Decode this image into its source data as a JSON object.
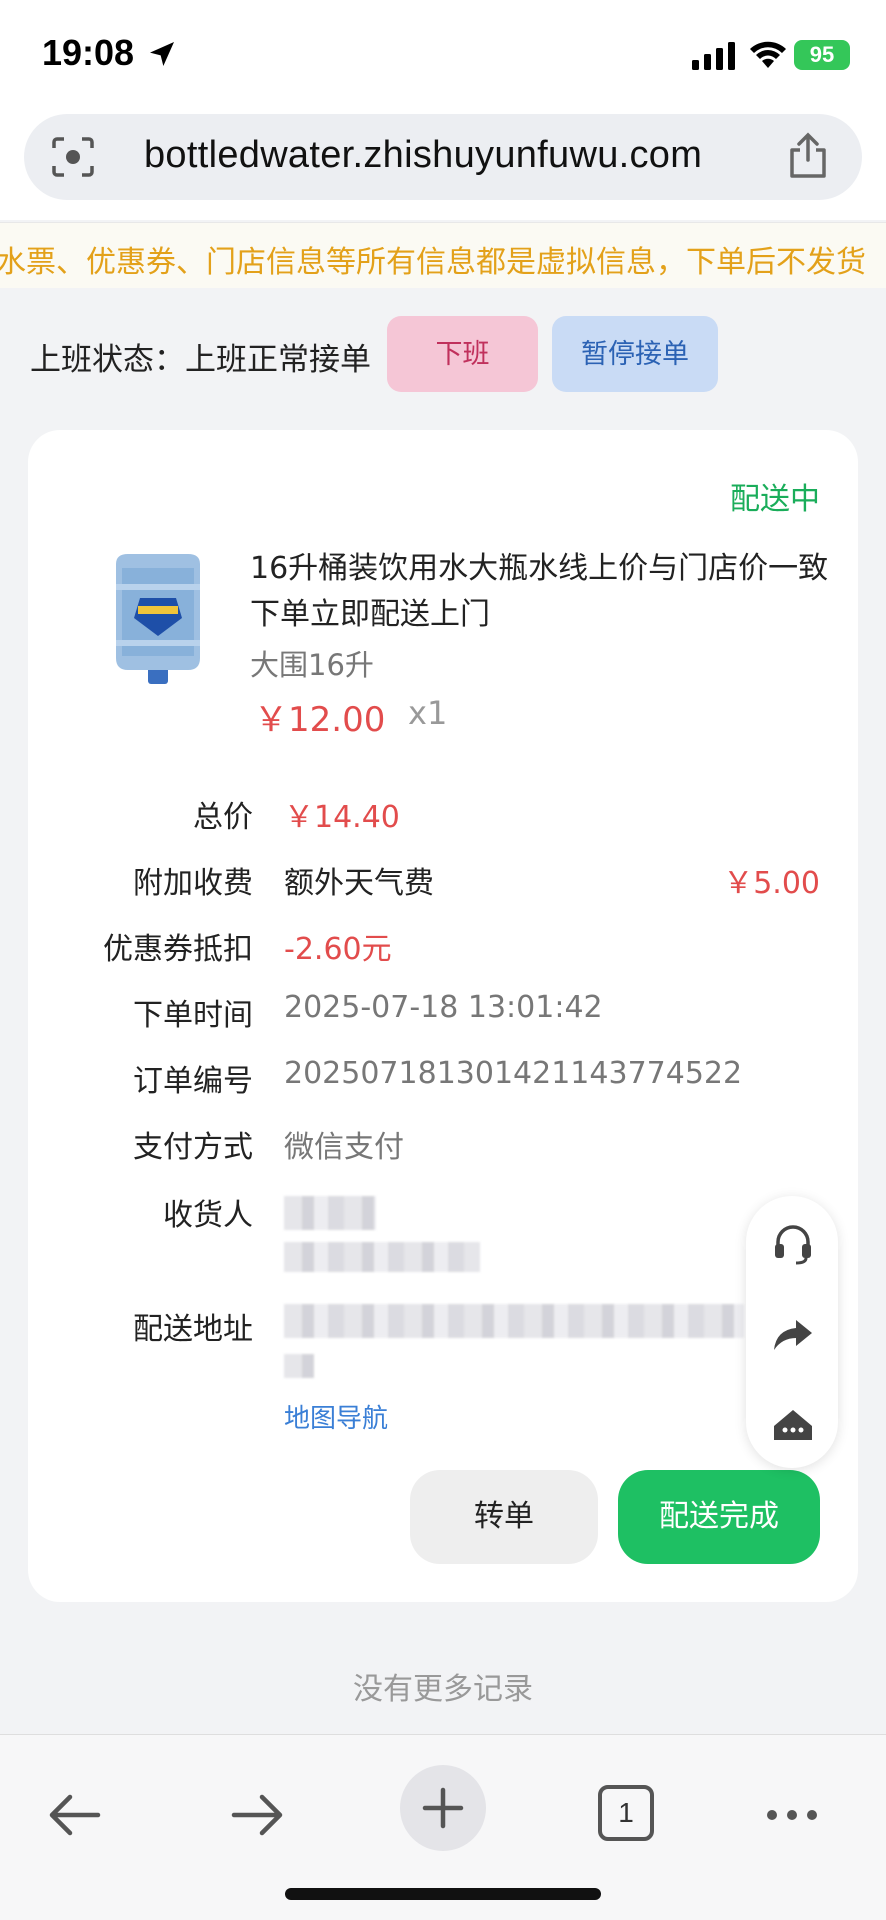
{
  "status_bar": {
    "time": "19:08",
    "battery": "95"
  },
  "browser": {
    "url": "bottledwater.zhishuyunfuwu.com"
  },
  "notice": {
    "text": "水票、优惠券、门店信息等所有信息都是虚拟信息，下单后不发货"
  },
  "work_status": {
    "label": "上班状态：上班正常接单",
    "off_button": "下班",
    "pause_button": "暂停接单"
  },
  "order": {
    "status": "配送中",
    "product": {
      "title": "16升桶装饮用水大瓶水线上价与门店价一致下单立即配送上门",
      "spec": "大围16升",
      "price": "￥12.00",
      "qty": "x1"
    },
    "details": {
      "total_label": "总价",
      "total_value": "￥14.40",
      "surcharge_label": "附加收费",
      "surcharge_name": "额外天气费",
      "surcharge_value": "￥5.00",
      "coupon_label": "优惠券抵扣",
      "coupon_value": "-2.60元",
      "time_label": "下单时间",
      "time_value": "2025-07-18 13:01:42",
      "order_no_label": "订单编号",
      "order_no_value": "202507181301421143774522",
      "pay_label": "支付方式",
      "pay_value": "微信支付",
      "receiver_label": "收货人",
      "address_label": "配送地址",
      "map_nav": "地图导航"
    },
    "actions": {
      "transfer": "转单",
      "done": "配送完成"
    }
  },
  "footer": {
    "no_more": "没有更多记录"
  },
  "toolbar": {
    "tab_count": "1"
  },
  "colors": {
    "accent_green": "#1ec063",
    "price_red": "#e24c4c",
    "notice_yellow": "#e3a11a",
    "link_blue": "#3a7fd6"
  }
}
